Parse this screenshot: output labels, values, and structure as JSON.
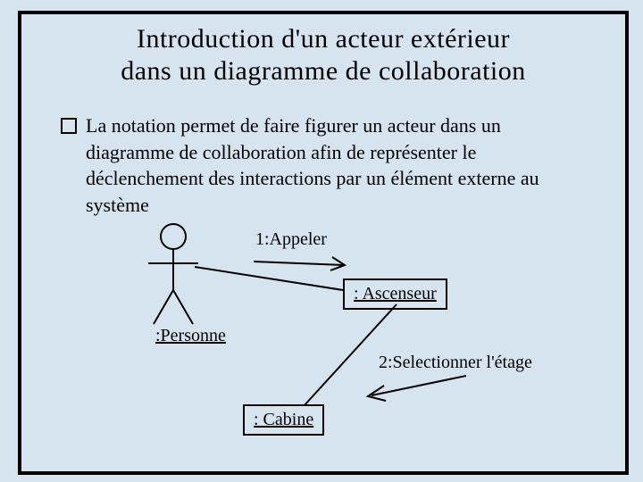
{
  "title_line1": "Introduction d'un acteur extérieur",
  "title_line2": "dans un diagramme de collaboration",
  "bullet": "La notation permet de faire figurer un acteur dans un diagramme de collaboration afin de représenter le déclenchement des interactions par un élément externe au système",
  "diagram": {
    "msg1": "1:Appeler",
    "msg2": "2:Selectionner l'étage",
    "box_ascenseur": ": Ascenseur",
    "box_cabine": ": Cabine",
    "label_personne": ":Personne"
  }
}
